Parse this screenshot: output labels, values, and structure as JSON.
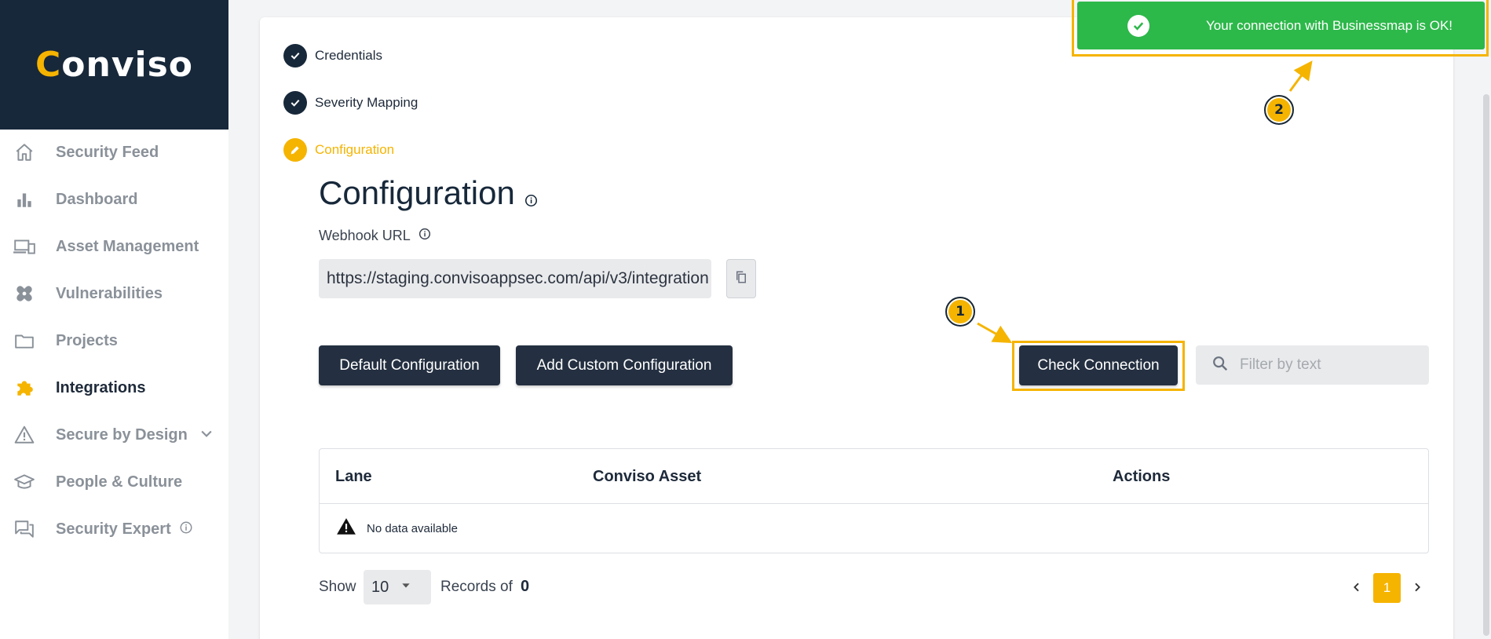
{
  "brand": {
    "logo_text": "Conviso",
    "logo_first_letter": "C",
    "logo_rest": "onviso"
  },
  "colors": {
    "navy": "#17283a",
    "accent": "#f5b400",
    "success": "#2db84a",
    "button": "#243041"
  },
  "sidebar": {
    "items": [
      {
        "label": "Security Feed",
        "icon": "home-icon"
      },
      {
        "label": "Dashboard",
        "icon": "bar-chart-icon"
      },
      {
        "label": "Asset Management",
        "icon": "devices-icon"
      },
      {
        "label": "Vulnerabilities",
        "icon": "bandage-icon"
      },
      {
        "label": "Projects",
        "icon": "folder-icon"
      },
      {
        "label": "Integrations",
        "icon": "puzzle-icon",
        "active": true
      },
      {
        "label": "Secure by Design",
        "icon": "warning-triangle-icon",
        "expandable": true
      },
      {
        "label": "People & Culture",
        "icon": "graduation-cap-icon"
      },
      {
        "label": "Security Expert",
        "icon": "chat-icon",
        "info": true
      }
    ]
  },
  "steps": [
    {
      "label": "Credentials",
      "state": "done"
    },
    {
      "label": "Severity Mapping",
      "state": "done"
    },
    {
      "label": "Configuration",
      "state": "current"
    }
  ],
  "page": {
    "title": "Configuration",
    "webhook_label": "Webhook URL",
    "webhook_value": "https://staging.convisoappsec.com/api/v3/integration"
  },
  "actions": {
    "default_config": "Default Configuration",
    "add_custom_config": "Add Custom Configuration",
    "check_connection": "Check Connection",
    "filter_placeholder": "Filter by text"
  },
  "table": {
    "columns": [
      "Lane",
      "Conviso Asset",
      "Actions"
    ],
    "empty_text": "No data available"
  },
  "pagination": {
    "show_label": "Show",
    "page_size": "10",
    "records_label": "Records of",
    "records_count": "0",
    "current_page": "1"
  },
  "toast": {
    "message": "Your connection with Businessmap is OK!"
  },
  "callouts": [
    "1",
    "2"
  ]
}
